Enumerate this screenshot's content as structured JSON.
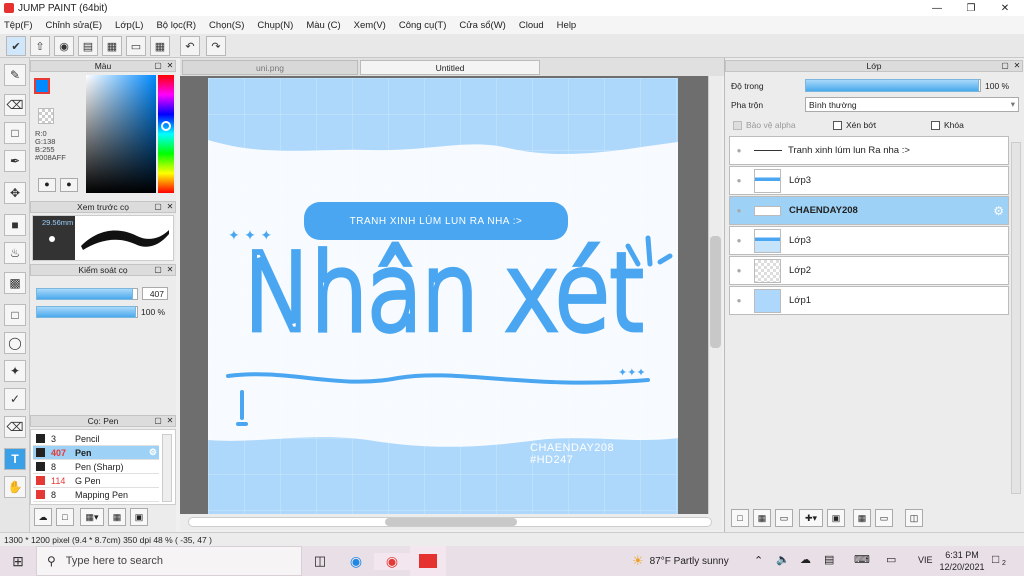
{
  "window": {
    "title": "JUMP PAINT (64bit)"
  },
  "menu": [
    "Tệp(F)",
    "Chỉnh sửa(E)",
    "Lớp(L)",
    "Bộ lọc(R)",
    "Chọn(S)",
    "Chụp(N)",
    "Màu (C)",
    "Xem(V)",
    "Công cụ(T)",
    "Cửa sổ(W)",
    "Cloud",
    "Help"
  ],
  "color_panel": {
    "title": "Màu",
    "r": "R:0",
    "g": "G:138",
    "b": "B:255",
    "hex": "#008AFF",
    "primary": "#008aff"
  },
  "brush_preview": {
    "title": "Xem trước cọ",
    "size": "29.56mm"
  },
  "brush_control": {
    "title": "Kiểm soát cọ",
    "size_value": "407",
    "size_fraction": 0.97,
    "opacity_value": "100 %",
    "opacity_fraction": 1.0
  },
  "brush_list": {
    "title": "Cọ: Pen",
    "items": [
      {
        "num": "3",
        "name": "Pencil",
        "color": "#222222",
        "selected": false
      },
      {
        "num": "407",
        "name": "Pen",
        "color": "#222222",
        "selected": true
      },
      {
        "num": "8",
        "name": "Pen (Sharp)",
        "color": "#222222",
        "selected": false
      },
      {
        "num": "114",
        "name": "G Pen",
        "color": "#e53935",
        "selected": false
      },
      {
        "num": "8",
        "name": "Mapping Pen",
        "color": "#e53935",
        "selected": false
      }
    ]
  },
  "tabs": [
    {
      "label": "uni.png",
      "active": false
    },
    {
      "label": "Untitled",
      "active": true
    }
  ],
  "artwork": {
    "banner": "TRANH XINH LÚM LUN RA NHA :>",
    "main_title": "Nhân xét",
    "credit_line1": "CHAENDAY208",
    "credit_line2": "#HD247",
    "accent": "#4aa6f0"
  },
  "layers_panel": {
    "title": "Lớp",
    "opacity_label": "Độ trong",
    "opacity_value": "100 %",
    "opacity_fraction": 1.0,
    "blend_label": "Pha trộn",
    "blend_value": "Bình thường",
    "protect_alpha": "Bảo vệ alpha",
    "clip": "Xén bớt",
    "lock": "Khóa",
    "layers": [
      {
        "name": "Tranh xinh lúm lun Ra nha :>",
        "type": "text",
        "selected": false
      },
      {
        "name": "Lớp3",
        "type": "image",
        "selected": false
      },
      {
        "name": "CHAENDAY208",
        "type": "image",
        "selected": true
      },
      {
        "name": "Lớp3",
        "type": "image",
        "selected": false
      },
      {
        "name": "Lớp2",
        "type": "empty",
        "selected": false
      },
      {
        "name": "Lớp1",
        "type": "image",
        "selected": false
      }
    ]
  },
  "status": {
    "text": "1300 * 1200 pixel  (9.4 * 8.7cm)  350 dpi  48 %  ( -35, 47 )"
  },
  "taskbar": {
    "search_placeholder": "Type here to search",
    "weather": "87°F  Partly sunny",
    "lang": "VIE",
    "time": "6:31 PM",
    "date": "12/20/2021",
    "notif": "2"
  }
}
